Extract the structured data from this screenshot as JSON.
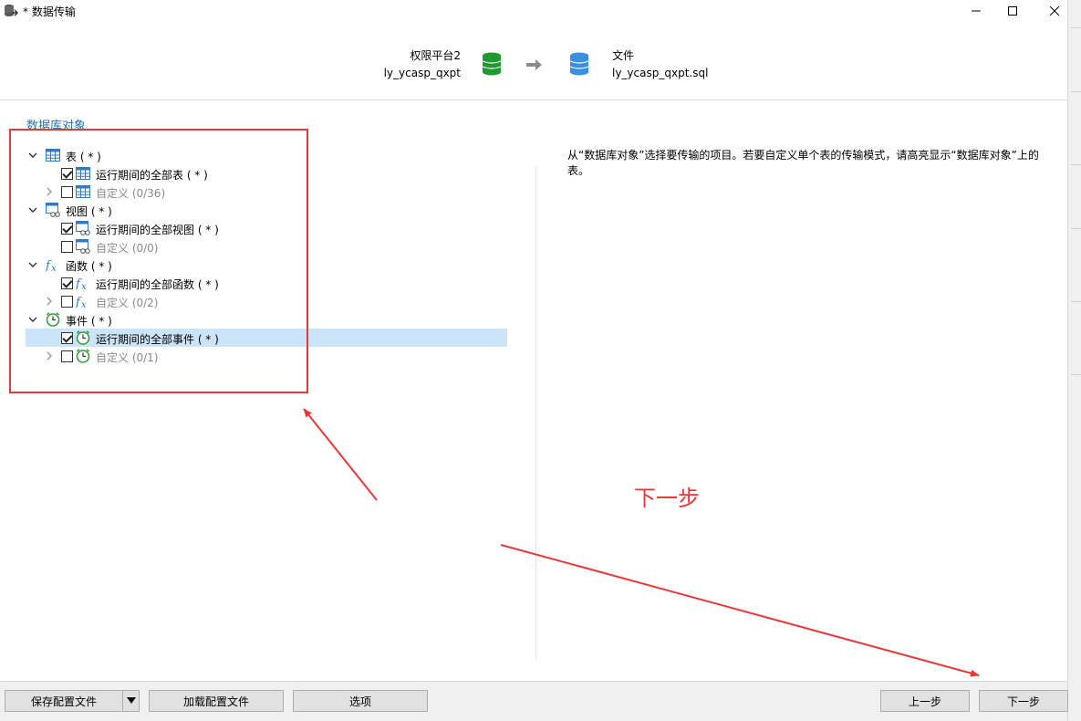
{
  "window": {
    "title": "* 数据传输"
  },
  "header": {
    "source": {
      "connection": "权限平台2",
      "database": "ly_ycasp_qxpt",
      "icon_color": "#2aa52a"
    },
    "target": {
      "type": "文件",
      "name": "ly_ycasp_qxpt.sql",
      "icon_color": "#3b8fe0"
    }
  },
  "section": {
    "title": "数据库对象"
  },
  "tree": [
    {
      "kind": "group",
      "icon": "table-icon",
      "label": "表 ( * )"
    },
    {
      "kind": "child",
      "icon": "table-icon",
      "checked": true,
      "label": "运行期间的全部表 ( * )"
    },
    {
      "kind": "child-expandable",
      "icon": "table-icon",
      "checked": false,
      "label": "自定义 (0/36)"
    },
    {
      "kind": "group",
      "icon": "view-icon",
      "label": "视图 ( * )"
    },
    {
      "kind": "child",
      "icon": "view-icon",
      "checked": true,
      "label": "运行期间的全部视图 ( * )"
    },
    {
      "kind": "child",
      "icon": "view-icon",
      "checked": false,
      "label": "自定义 (0/0)"
    },
    {
      "kind": "group",
      "icon": "function-icon",
      "label": "函数 ( * )"
    },
    {
      "kind": "child",
      "icon": "function-icon",
      "checked": true,
      "label": "运行期间的全部函数 ( * )"
    },
    {
      "kind": "child-expandable",
      "icon": "function-icon",
      "checked": false,
      "label": "自定义 (0/2)"
    },
    {
      "kind": "group",
      "icon": "event-clock-icon",
      "label": "事件 ( * )"
    },
    {
      "kind": "child",
      "icon": "event-clock-icon",
      "checked": true,
      "label": "运行期间的全部事件 ( * )",
      "selected": true
    },
    {
      "kind": "child-expandable",
      "icon": "event-clock-icon",
      "checked": false,
      "label": "自定义 (0/1)"
    }
  ],
  "description": "从“数据库对象”选择要传输的项目。若要自定义单个表的传输模式，请高亮显示“数据库对象”上的表。",
  "annotation": {
    "text": "下一步",
    "color": "#e8393a"
  },
  "footer": {
    "save_config": "保存配置文件",
    "load_config": "加载配置文件",
    "options": "选项",
    "prev": "上一步",
    "next": "下一步"
  }
}
